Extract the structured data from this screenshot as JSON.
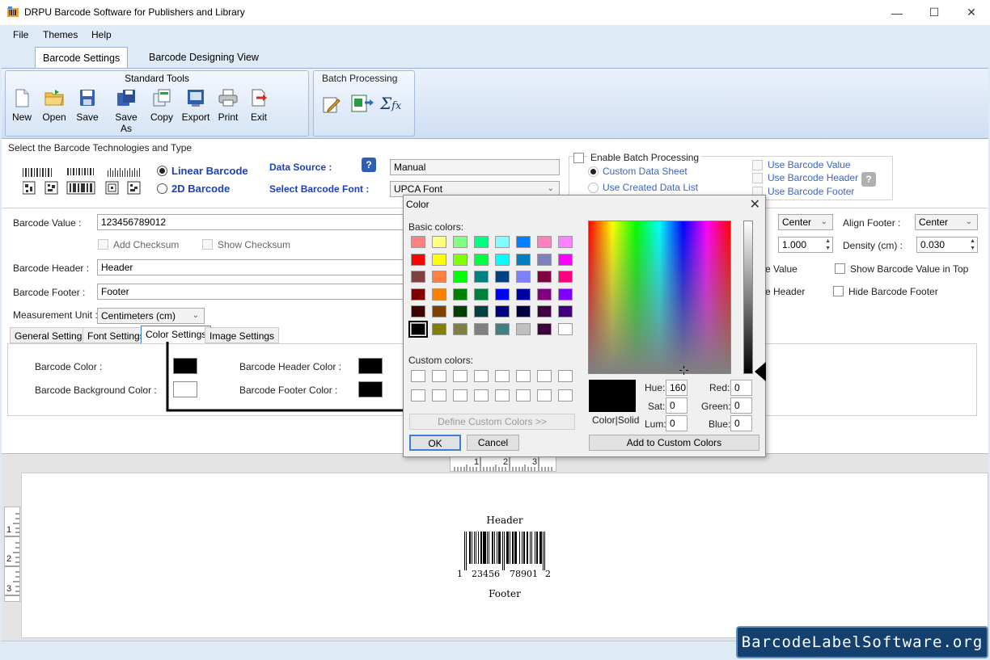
{
  "window": {
    "title": "DRPU Barcode Software for Publishers and Library"
  },
  "menu": {
    "file": "File",
    "themes": "Themes",
    "help": "Help"
  },
  "tabs": {
    "barcode_settings": "Barcode Settings",
    "designing_view": "Barcode Designing View"
  },
  "ribbon": {
    "standard_title": "Standard Tools",
    "batch_title": "Batch Processing",
    "tools": {
      "new": "New",
      "open": "Open",
      "save": "Save",
      "save_as": "Save As",
      "copy": "Copy",
      "export": "Export",
      "print": "Print",
      "exit": "Exit"
    }
  },
  "tech": {
    "section_title": "Select the Barcode Technologies and Type",
    "linear": "Linear Barcode",
    "twod": "2D Barcode",
    "data_source_label": "Data Source :",
    "data_source_value": "Manual",
    "font_label": "Select Barcode Font :",
    "font_value": "UPCA Font"
  },
  "batch": {
    "enable": "Enable Batch Processing",
    "custom_sheet": "Custom Data Sheet",
    "created_list": "Use Created Data List",
    "use_value": "Use Barcode Value",
    "use_header": "Use Barcode Header",
    "use_footer": "Use Barcode Footer"
  },
  "form": {
    "value_label": "Barcode Value :",
    "value": "123456789012",
    "add_checksum": "Add Checksum",
    "show_checksum": "Show Checksum",
    "header_label": "Barcode Header :",
    "header": "Header",
    "footer_label": "Barcode Footer :",
    "footer": "Footer",
    "unit_label": "Measurement Unit :",
    "unit": "Centimeters (cm)",
    "align_header_value": "Center",
    "align_footer_label": "Align Footer :",
    "align_footer_value": "Center",
    "ratio_value": "1.000",
    "density_label": "Density (cm) :",
    "density_value": "0.030",
    "value_partial": "e Value",
    "show_value_top": "Show Barcode Value in Top",
    "header_partial": "e Header",
    "hide_footer": "Hide Barcode Footer"
  },
  "subtabs": {
    "general": "General Settings",
    "font": "Font Settings",
    "color": "Color Settings",
    "image": "Image Settings"
  },
  "colors": {
    "barcode_color": "Barcode Color :",
    "bg_color": "Barcode Background Color :",
    "header_color": "Barcode Header Color :",
    "footer_color": "Barcode Footer Color :",
    "barcode_swatch": "#000000",
    "bg_swatch": "#ffffff",
    "header_swatch": "#000000",
    "footer_swatch": "#000000"
  },
  "dialog": {
    "title": "Color",
    "basic_label": "Basic colors:",
    "custom_label": "Custom colors:",
    "define_btn": "Define Custom Colors >>",
    "ok": "OK",
    "cancel": "Cancel",
    "colorsolid": "Color|Solid",
    "hue_label": "Hue:",
    "hue": "160",
    "sat_label": "Sat:",
    "sat": "0",
    "lum_label": "Lum:",
    "lum": "0",
    "red_label": "Red:",
    "red": "0",
    "green_label": "Green:",
    "green": "0",
    "blue_label": "Blue:",
    "blue": "0",
    "add_custom": "Add to Custom Colors",
    "basic_colors": [
      "#ff8080",
      "#ffff80",
      "#80ff80",
      "#00ff80",
      "#80ffff",
      "#0080ff",
      "#ff80c0",
      "#ff80ff",
      "#ff0000",
      "#ffff00",
      "#80ff00",
      "#00ff40",
      "#00ffff",
      "#0080c0",
      "#8080c0",
      "#ff00ff",
      "#804040",
      "#ff8040",
      "#00ff00",
      "#008080",
      "#004080",
      "#8080ff",
      "#800040",
      "#ff0080",
      "#800000",
      "#ff8000",
      "#008000",
      "#008040",
      "#0000ff",
      "#0000a0",
      "#800080",
      "#8000ff",
      "#400000",
      "#804000",
      "#004000",
      "#004040",
      "#000080",
      "#000040",
      "#400040",
      "#400080",
      "#000000",
      "#808000",
      "#808040",
      "#808080",
      "#408080",
      "#c0c0c0",
      "#400040",
      "#ffffff"
    ]
  },
  "preview": {
    "header": "Header",
    "footer": "Footer",
    "digit_left": "1",
    "digits_a": "23456",
    "digits_b": "78901",
    "digit_right": "2",
    "ruler_top": [
      "1",
      "2",
      "3"
    ],
    "ruler_left": [
      "1",
      "2",
      "3"
    ]
  },
  "watermark": "BarcodeLabelSoftware.org"
}
